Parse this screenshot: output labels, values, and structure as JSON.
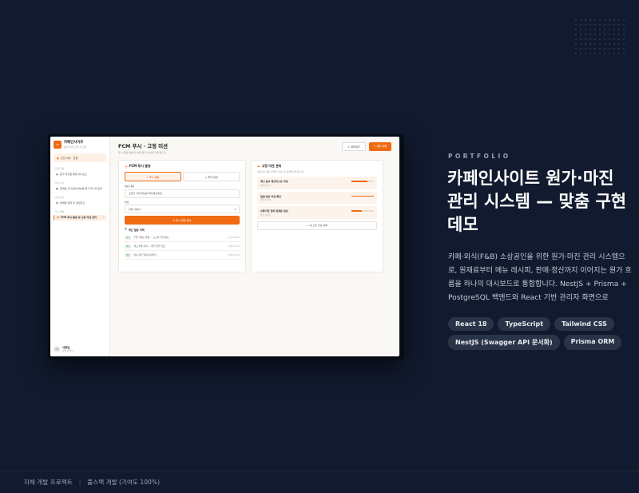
{
  "app": {
    "brand": "카페인사이트",
    "brand_sub": "원가·마진 관리 시스템",
    "store": "강남 대로 · 본점",
    "sidebar": {
      "groups": [
        {
          "label": "운영 현황",
          "items": [
            {
              "label": "원가·마진율 통합 대시보드",
              "icon": "chart-icon"
            }
          ]
        },
        {
          "label": "원가 관리",
          "items": [
            {
              "label": "원재료 단가표와 메뉴별 원가 레시피 관리",
              "icon": "clipboard-icon"
            }
          ]
        },
        {
          "label": "판매·정산",
          "items": [
            {
              "label": "판매량 입력 및 일일정산",
              "icon": "receipt-icon"
            }
          ]
        },
        {
          "label": "푸시 알림",
          "items": [
            {
              "label": "FCM 푸시 발송 및 고정 미션 관리",
              "icon": "bell-icon",
              "active": true
            }
          ]
        }
      ]
    },
    "user": {
      "avatar": "사장",
      "name": "사장님",
      "role": "점주 관리자"
    },
    "page": {
      "title": "FCM 푸시 · 고정 미션",
      "subtitle": "푸시 알림 발송과 반복 업무 미션을 관리합니다",
      "export_label": "내보내기",
      "create_label": "새로 등록"
    },
    "push_card": {
      "title": "FCM 푸시 발송",
      "toggle_now": "즉시 발송",
      "toggle_reserve": "예약 발송",
      "field_content_label": "발송 내용",
      "field_content_value": "오늘의 추천 메뉴를 확인해보세요!",
      "field_target_label": "대상",
      "field_target_value": "전체 사용자",
      "send_label": "푸시 발송 접수",
      "history_title": "최근 발송 이력",
      "history": [
        {
          "badge": "완료",
          "text": "주말 신메뉴 알림 — 오늘의 추천 메뉴",
          "time": "오늘 09:00"
        },
        {
          "badge": "완료",
          "text": "재고 부족 안내 — 원두 발주 필요",
          "time": "어제 18:42"
        },
        {
          "badge": "완료",
          "text": "마감 정산 알림 리마인더",
          "time": "어제 22:10"
        }
      ]
    },
    "mission_card": {
      "title": "고정 미션 관리",
      "subtitle": "반복되는 매장 업무를 미션으로 등록해 관리합니다",
      "missions": [
        {
          "name": "재고 실사 체크리스트 작성",
          "desc": "매일 마감 후",
          "progress": 0.7
        },
        {
          "name": "일일 정산 마감 확인",
          "desc": "매일 22:00",
          "progress": 1.0
        },
        {
          "name": "유통기한 임박 원재료 점검",
          "desc": "매주 월요일",
          "progress": 0.45
        }
      ],
      "add_label": "새 고정 미션 등록"
    }
  },
  "portfolio": {
    "eyebrow": "PORTFOLIO",
    "headline": "카페인사이트 원가·마진 관리 시스템 — 맞춤 구현 데모",
    "description": "카페·외식(F&B) 소상공인을 위한 원가·마진 관리 시스템으로, 원재료부터 메뉴 레시피, 판매·정산까지 이어지는 원가 흐름을 하나의 대시보드로 통합합니다. NestJS + Prisma + PostgreSQL 백엔드와 React 기반 관리자 화면으로",
    "tags": [
      "React 18",
      "TypeScript",
      "Tailwind CSS",
      "NestJS (Swagger API 문서화)",
      "Prisma ORM"
    ]
  },
  "footer": {
    "left": "자체 개발 프로젝트",
    "sep": "|",
    "right": "풀스택 개발 (기여도 100%)"
  },
  "colors": {
    "background": "#111a2e",
    "accent": "#f06a12",
    "tag_bg": "#2a3448"
  }
}
